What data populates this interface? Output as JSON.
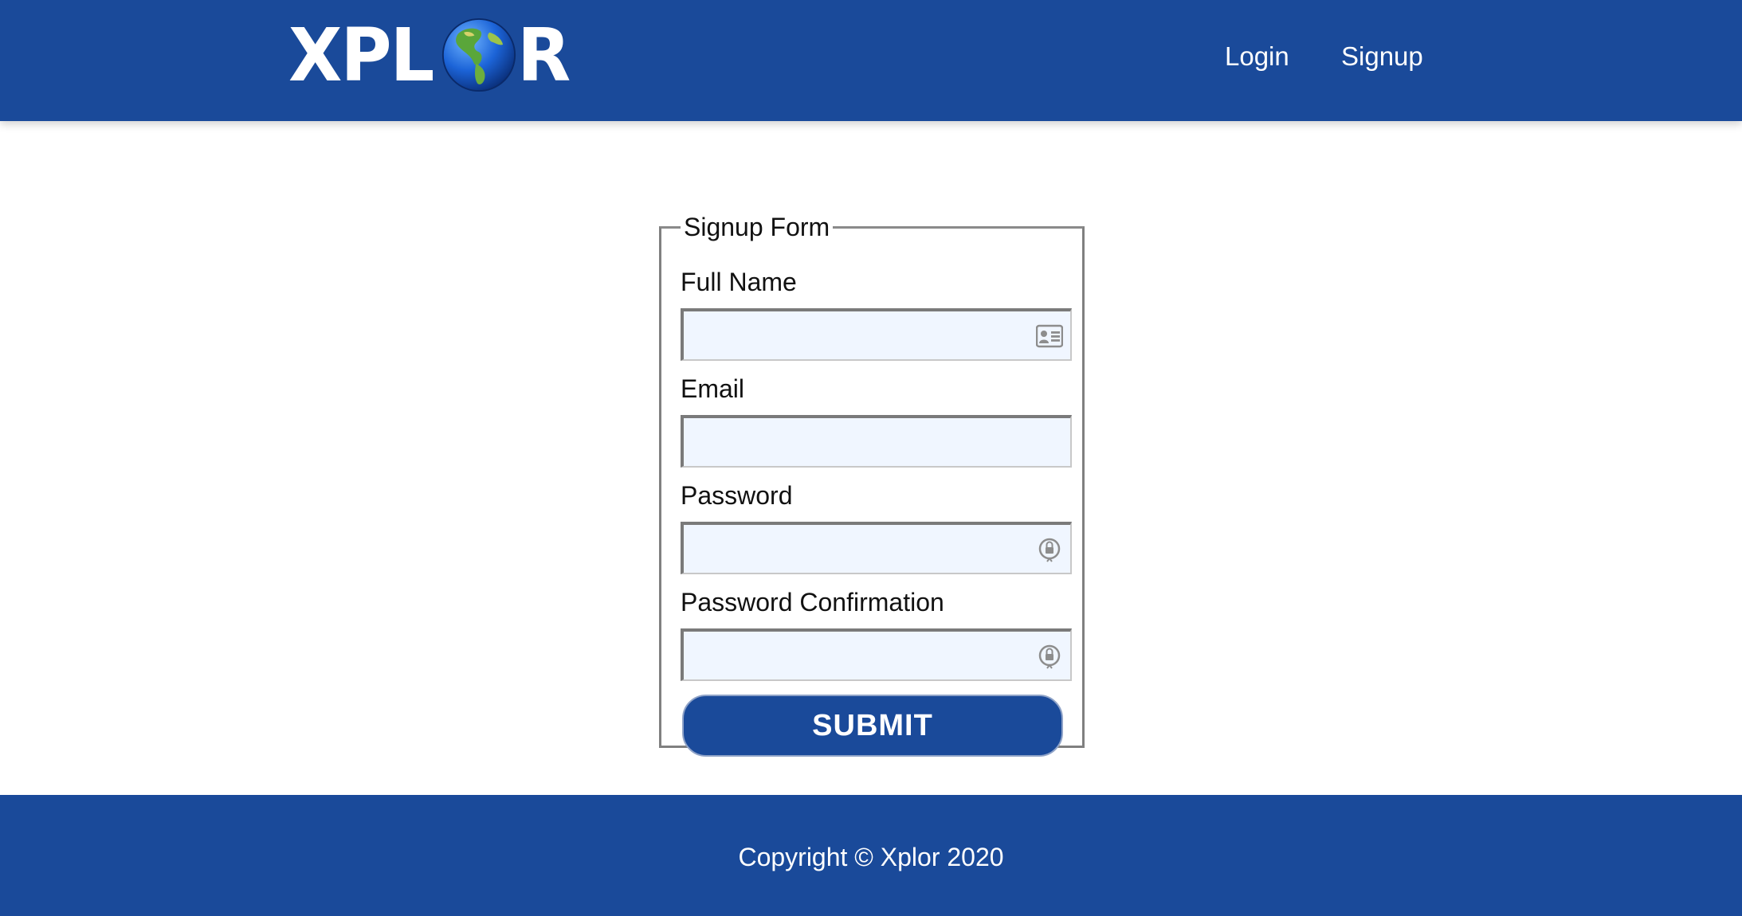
{
  "header": {
    "logo": {
      "text_left": "XPL",
      "text_right": "R",
      "icon": "globe-icon"
    },
    "nav": {
      "login_label": "Login",
      "signup_label": "Signup"
    }
  },
  "signup_form": {
    "legend": "Signup Form",
    "fields": [
      {
        "label": "Full Name",
        "value": "",
        "placeholder": "",
        "icon": "contact-card-icon"
      },
      {
        "label": "Email",
        "value": "",
        "placeholder": "",
        "icon": ""
      },
      {
        "label": "Password",
        "value": "",
        "placeholder": "",
        "icon": "password-key-icon"
      },
      {
        "label": "Password Confirmation",
        "value": "",
        "placeholder": "",
        "icon": "password-key-icon"
      }
    ],
    "submit_label": "SUBMIT"
  },
  "footer": {
    "copyright": "Copyright © Xplor 2020"
  },
  "colors": {
    "brand": "#1a4a9a",
    "input_background": "#f0f6ff",
    "text": "#111111"
  }
}
